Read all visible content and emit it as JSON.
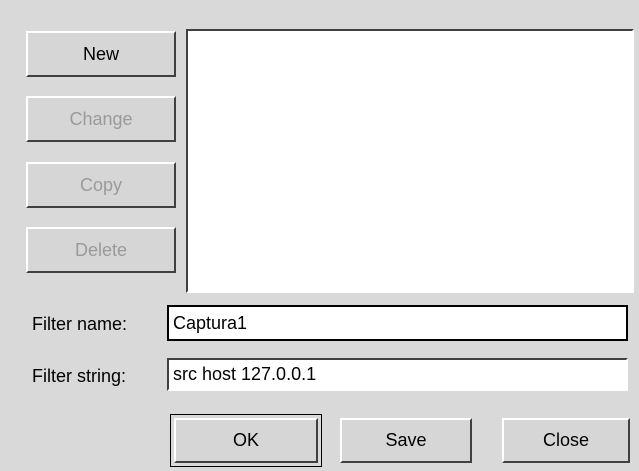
{
  "buttons": {
    "new": "New",
    "change": "Change",
    "copy": "Copy",
    "delete": "Delete",
    "ok": "OK",
    "save": "Save",
    "close": "Close"
  },
  "filter_list": {
    "items": []
  },
  "form": {
    "name_label": "Filter name:",
    "name_value": "Captura1",
    "string_label": "Filter string:",
    "string_value": "src host 127.0.0.1"
  },
  "colors": {
    "window_bg": "#d9d9d9",
    "disabled_text": "#9a9a9a"
  }
}
